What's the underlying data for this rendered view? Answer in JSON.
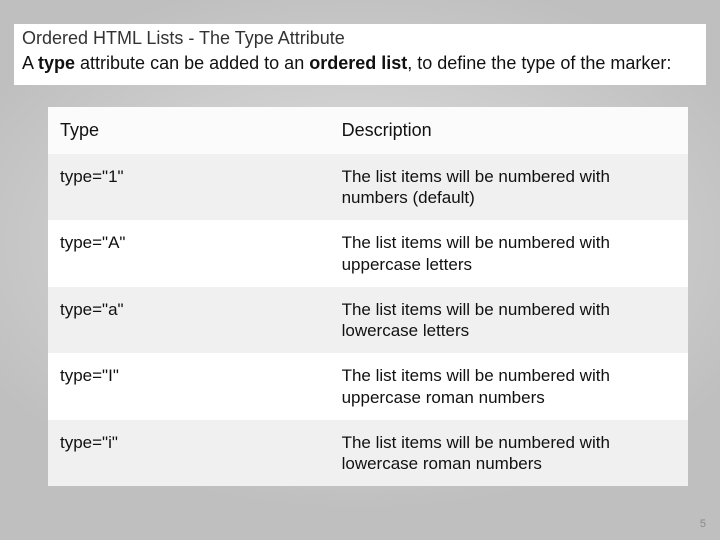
{
  "header": {
    "title": "Ordered HTML Lists - The Type Attribute",
    "subtitle_pre": "A ",
    "subtitle_b1": "type",
    "subtitle_mid": " attribute can be added to an ",
    "subtitle_b2": "ordered list",
    "subtitle_post": ", to define the type of the marker:"
  },
  "table": {
    "col1": "Type",
    "col2": "Description",
    "rows": [
      {
        "type": "type=\"1\"",
        "desc": "The list items will be numbered with numbers (default)"
      },
      {
        "type": "type=\"A\"",
        "desc": "The list items will be numbered with uppercase letters"
      },
      {
        "type": "type=\"a\"",
        "desc": "The list items will be numbered with lowercase letters"
      },
      {
        "type": "type=\"I\"",
        "desc": "The list items will be numbered with uppercase roman numbers"
      },
      {
        "type": "type=\"i\"",
        "desc": "The list items will be numbered with lowercase roman numbers"
      }
    ]
  },
  "page_number": "5"
}
